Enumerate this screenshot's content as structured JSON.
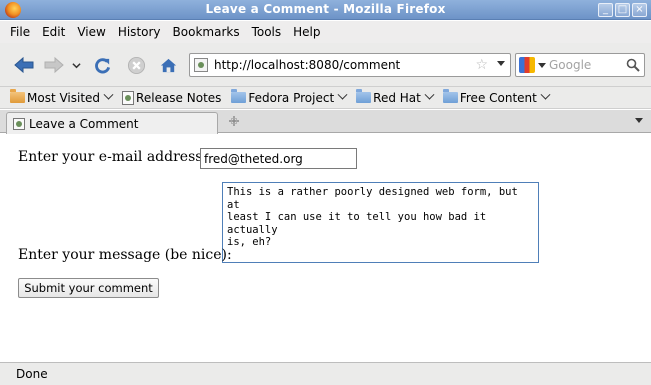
{
  "window": {
    "title": "Leave a Comment - Mozilla Firefox",
    "controls": [
      "_",
      "□",
      "×"
    ]
  },
  "menu": {
    "items": [
      "File",
      "Edit",
      "View",
      "History",
      "Bookmarks",
      "Tools",
      "Help"
    ]
  },
  "navigation": {
    "url": "http://localhost:8080/comment",
    "search_placeholder": "Google"
  },
  "bookmarks": {
    "items": [
      {
        "label": "Most Visited",
        "icon": "folder-icon",
        "has_dropdown": true
      },
      {
        "label": "Release Notes",
        "icon": "page-icon",
        "has_dropdown": false
      },
      {
        "label": "Fedora Project",
        "icon": "folder-icon",
        "has_dropdown": true
      },
      {
        "label": "Red Hat",
        "icon": "folder-icon",
        "has_dropdown": true
      },
      {
        "label": "Free Content",
        "icon": "folder-icon",
        "has_dropdown": true
      }
    ]
  },
  "tabs": {
    "active": "Leave a Comment"
  },
  "form": {
    "email_label": "Enter your e-mail address:",
    "email_value": "fred@theted.org",
    "message_label": "Enter your message (be nice):",
    "message_value": "This is a rather poorly designed web form, but at\nleast I can use it to tell you how bad it actually\nis, eh?",
    "submit_label": "Submit your comment"
  },
  "status": {
    "text": "Done"
  },
  "colors": {
    "titlebar": "#7a9dcd",
    "chrome": "#ebebea",
    "textarea_focus_border": "#4f7fb8"
  }
}
